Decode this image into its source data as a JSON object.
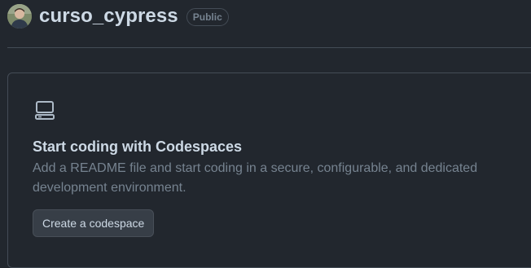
{
  "repo": {
    "name": "curso_cypress",
    "visibility": "Public"
  },
  "codespaces": {
    "icon": "device-desktop-icon",
    "title": "Start coding with Codespaces",
    "description": "Add a README file and start coding in a secure, configurable, and dedicated development environment.",
    "create_button_label": "Create a codespace"
  },
  "colors": {
    "background": "#22272e",
    "border": "#444c56",
    "text_primary": "#cdd9e5",
    "text_muted": "#768390",
    "button_bg": "#373e47"
  }
}
